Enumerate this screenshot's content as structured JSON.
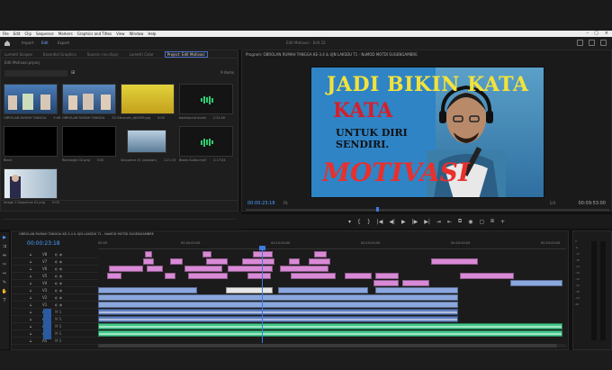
{
  "menu": {
    "items": [
      "File",
      "Edit",
      "Clip",
      "Sequence",
      "Markers",
      "Graphics and Titles",
      "View",
      "Window",
      "Help"
    ],
    "window_controls": [
      "–",
      "□",
      "×"
    ]
  },
  "workspaces": {
    "tabs": [
      "Import",
      "Edit",
      "Export"
    ],
    "active": "Edit",
    "title": "Edit Motivasi - Edit 22"
  },
  "project_panel": {
    "tabs": [
      "Lumetri Scopes",
      "Essential Graphics",
      "Source: (no clips)",
      "Lumetri Color",
      "Project: Edit Motivasi"
    ],
    "active_tab": "Project: Edit Motivasi",
    "path": "Edit Motivasi.prproj",
    "items_count": "9 items",
    "clips": [
      {
        "name": "OBROLAN RUMAH TANGGA",
        "duration": "5:06"
      },
      {
        "name": "OBROLAN RUMAH TANGGA",
        "duration": "52:34"
      },
      {
        "name": "sunset_dji0059.jpg",
        "duration": "5:00"
      },
      {
        "name": "backsound audio",
        "duration": "2:24:00"
      },
      {
        "name": "Black",
        "duration": ""
      },
      {
        "name": "Rectangle 02.png",
        "duration": "5:00"
      },
      {
        "name": "Sequence 01 (obrolan)",
        "duration": "1:21:15"
      },
      {
        "name": "Boom Audio.mp3",
        "duration": "2:17:04"
      },
      {
        "name": "Image 1 Sequence 01.png",
        "duration": "5:00"
      }
    ]
  },
  "program": {
    "title": "Program: OBROLAN RUMAH TANGGA KE-3.4 & UJN LAKSDU T1 - NaMOD MOTDI SUGENGAMBRE",
    "timecode_left": "00:00:23:18",
    "fit": "Fit",
    "ratio": "1/4",
    "timecode_right": "00:09:53:00",
    "video_text": {
      "line1": "JADI BIKIN KATA",
      "line2": "KATA",
      "line3": "UNTUK DIRI",
      "line4": "SENDIRI.",
      "line5": "MOTIVASI"
    },
    "transport": [
      "▾",
      "{",
      "}",
      "|◀",
      "◀|",
      "▶",
      "|▶",
      "▶|",
      "⇥",
      "⇤",
      "⧉",
      "◉",
      "▢",
      "⧈",
      "+"
    ]
  },
  "timeline": {
    "title": "OBROLAN RUMAH TANGGA KE-3.4 & UJN LAKSDU T1 - NaMOD MOTDI SUGENGAMBRE",
    "timecode": "00:00:23:18",
    "ruler_labels": [
      "00:00",
      "00:05:00:00",
      "00:10:00:00",
      "00:15:00:00",
      "00:20:00:00",
      "00:25:00:00"
    ],
    "tracks": [
      {
        "name": "V8"
      },
      {
        "name": "V7"
      },
      {
        "name": "V6"
      },
      {
        "name": "V5"
      },
      {
        "name": "V4"
      },
      {
        "name": "V3"
      },
      {
        "name": "V2"
      },
      {
        "name": "V1"
      },
      {
        "name": "A1"
      },
      {
        "name": "A2"
      },
      {
        "name": "A3"
      },
      {
        "name": "A4"
      },
      {
        "name": "A5"
      }
    ]
  },
  "meters": {
    "scale": [
      "0",
      "-6",
      "-12",
      "-18",
      "-24",
      "-30",
      "-36",
      "-42",
      "-48",
      "-54",
      "dB"
    ]
  }
}
